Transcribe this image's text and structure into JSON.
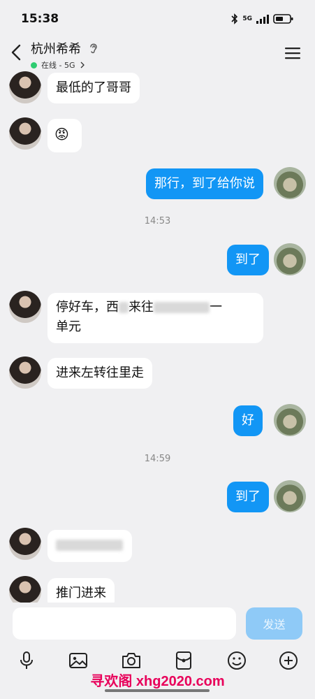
{
  "status_bar": {
    "time": "15:38",
    "network": "5G"
  },
  "header": {
    "contact_name": "杭州希希",
    "presence": "在线 - 5G"
  },
  "messages": {
    "m1": "最低的了哥哥",
    "m2_emoji": "😡",
    "m3": "那行，到了给你说",
    "ts1": "14:53",
    "m4": "到了",
    "m5_line1_a": "停好车，西",
    "m5_line1_b": "来往",
    "m5_line1_c": "一",
    "m5_line2": "单元",
    "m6": "进来左转往里走",
    "m7": "好",
    "ts2": "14:59",
    "m8": "到了",
    "m10_a": "推门进来"
  },
  "input": {
    "placeholder": "",
    "send_label": "发送"
  },
  "toolbar": {
    "icons": [
      "microphone-icon",
      "image-icon",
      "camera-icon",
      "red-packet-icon",
      "emoji-icon",
      "plus-icon"
    ]
  },
  "watermark": "寻欢阁 xhg2020.com",
  "colors": {
    "outgoing_bubble": "#1296f5",
    "send_button": "#8fcaf7",
    "presence": "#2ecc71",
    "watermark": "#e8005a"
  }
}
